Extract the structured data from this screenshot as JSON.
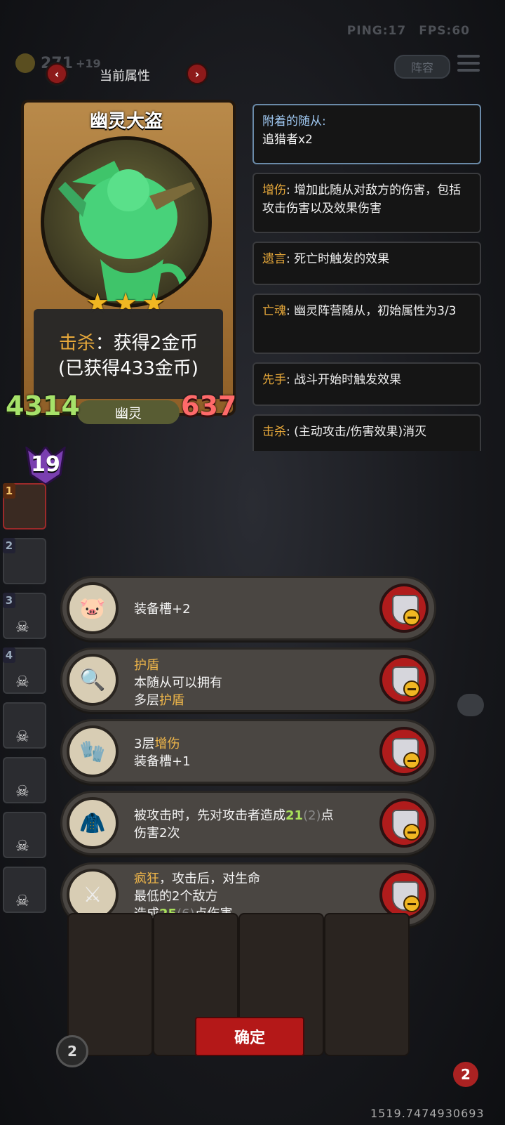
{
  "hud": {
    "ping": "PING:17",
    "fps": "FPS:60",
    "gold": "271",
    "gold_income": "+19",
    "lineup_label": "阵容"
  },
  "title": {
    "label": "当前属性",
    "prev": "‹",
    "next": "›"
  },
  "card": {
    "name": "幽灵大盗",
    "stars": 3,
    "star_glyph": "★",
    "kill_keyword": "击杀",
    "kill_text": "：获得2金币",
    "gained_text": "(已获得433金币)",
    "attack": "4314",
    "health": "637",
    "tribe": "幽灵",
    "level": "19"
  },
  "keywords": [
    {
      "label": "附着的随从:",
      "text": "追猎者x2"
    },
    {
      "label": "增伤",
      "text": ": 增加此随从对敌方的伤害，包括攻击伤害以及效果伤害"
    },
    {
      "label": "遗言",
      "text": ": 死亡时触发的效果"
    },
    {
      "label": "亡魂",
      "text": ": 幽灵阵营随从，初始属性为3/3"
    },
    {
      "label": "先手",
      "text": ": 战斗开始时触发效果"
    },
    {
      "label": "击杀",
      "text": ": (主动攻击/伤害效果)消灭"
    }
  ],
  "team_slots": [
    "1",
    "2",
    "3",
    "4",
    "",
    "",
    "",
    ""
  ],
  "equipment": [
    {
      "icon": "pig-mask-icon",
      "lines": [
        "装备槽+2"
      ]
    },
    {
      "icon": "magic-mirror-icon",
      "kw1": "护盾",
      "line2": "本随从可以拥有",
      "line3_pre": "多层",
      "line3_kw": "护盾"
    },
    {
      "icon": "armored-glove-icon",
      "line1_pre": "3层",
      "line1_kw": "增伤",
      "line2": "装备槽+1"
    },
    {
      "icon": "red-cloak-icon",
      "line1_pre": "被攻击时，先对攻击者造成",
      "line1_val": "21",
      "line1_dim": "(2)",
      "line1_post": "点",
      "line2": "伤害2次"
    },
    {
      "icon": "scythe-blades-icon",
      "line1_kw": "疯狂",
      "line1_post": "，攻击后，对生命",
      "line2": "最低的2个敌方",
      "line3_pre": "造成",
      "line3_val": "25",
      "line3_dim": "(6)",
      "line3_post": "点伤害"
    }
  ],
  "confirm_label": "确定",
  "bottom": {
    "stepper": "2",
    "hero_badge": "2",
    "coords": "1519.7474930693"
  }
}
